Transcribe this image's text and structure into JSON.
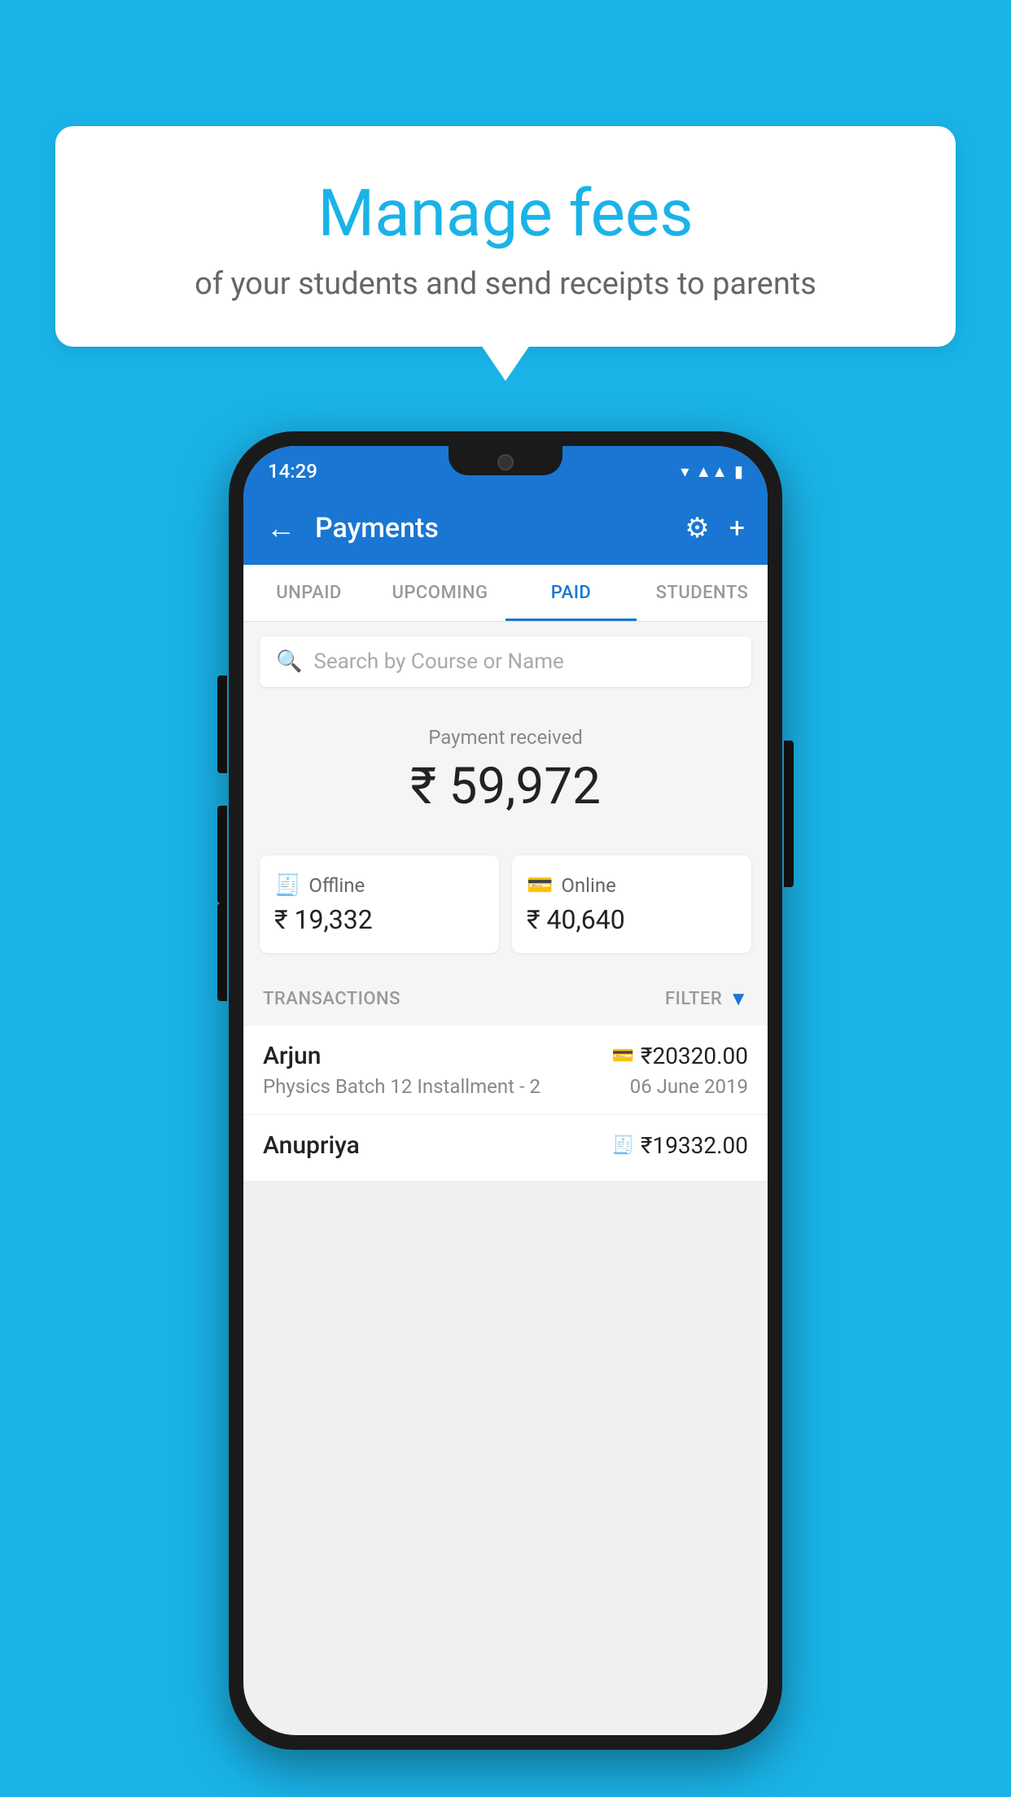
{
  "background_color": "#1ab3e8",
  "bubble": {
    "title": "Manage fees",
    "subtitle": "of your students and send receipts to parents"
  },
  "status_bar": {
    "time": "14:29"
  },
  "app_bar": {
    "title": "Payments",
    "back_label": "←",
    "gear_label": "⚙",
    "plus_label": "+"
  },
  "tabs": [
    {
      "id": "unpaid",
      "label": "UNPAID",
      "active": false
    },
    {
      "id": "upcoming",
      "label": "UPCOMING",
      "active": false
    },
    {
      "id": "paid",
      "label": "PAID",
      "active": true
    },
    {
      "id": "students",
      "label": "STUDENTS",
      "active": false
    }
  ],
  "search": {
    "placeholder": "Search by Course or Name"
  },
  "payment_summary": {
    "label": "Payment received",
    "amount": "₹ 59,972",
    "offline_label": "Offline",
    "offline_amount": "₹ 19,332",
    "online_label": "Online",
    "online_amount": "₹ 40,640"
  },
  "transactions_section": {
    "label": "TRANSACTIONS",
    "filter_label": "FILTER"
  },
  "transactions": [
    {
      "name": "Arjun",
      "amount": "₹20320.00",
      "description": "Physics Batch 12 Installment - 2",
      "date": "06 June 2019",
      "payment_type": "card"
    },
    {
      "name": "Anupriya",
      "amount": "₹19332.00",
      "description": "",
      "date": "",
      "payment_type": "offline"
    }
  ]
}
